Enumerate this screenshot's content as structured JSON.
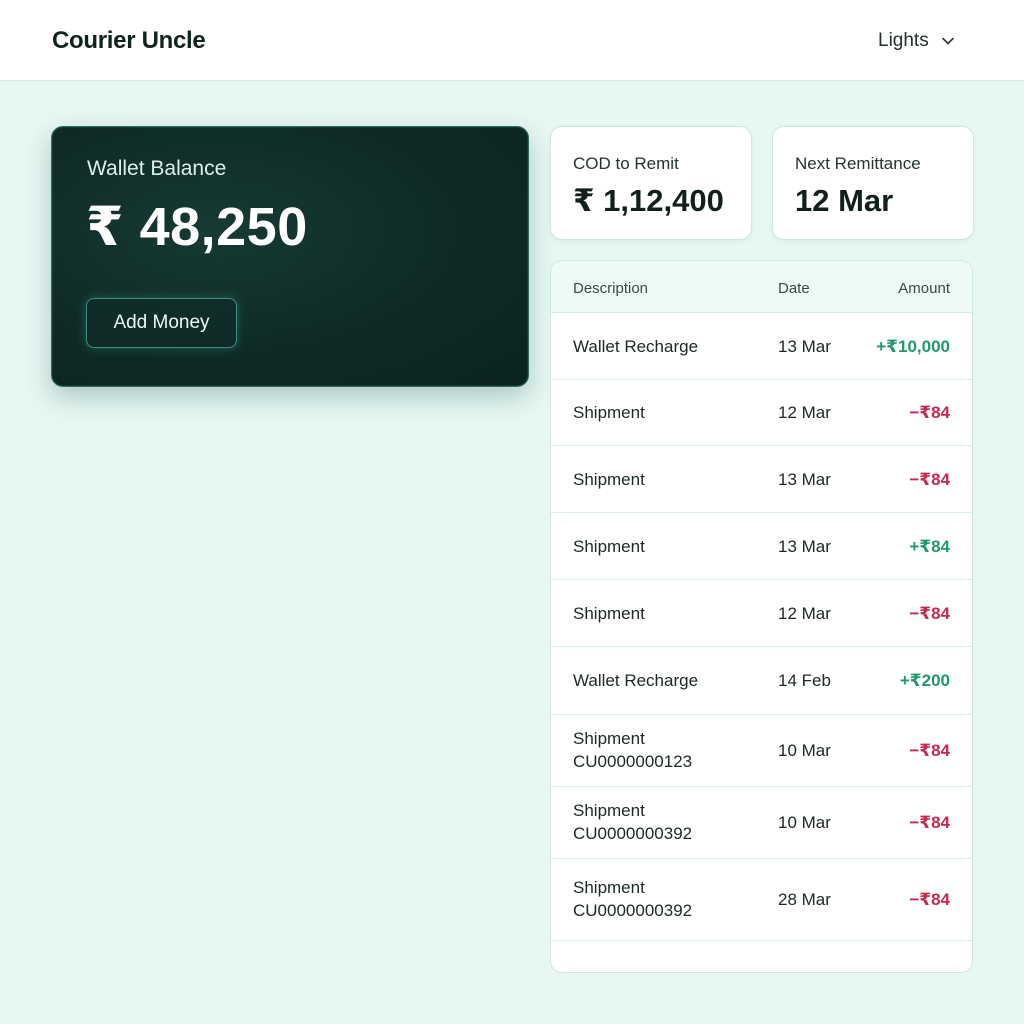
{
  "header": {
    "brand": "Courier Uncle",
    "theme_label": "Lights"
  },
  "wallet": {
    "label": "Wallet Balance",
    "amount": "₹ 48,250",
    "add_button": "Add Money"
  },
  "stats": {
    "cod": {
      "label": "COD to Remit",
      "value": "₹ 1,12,400"
    },
    "next": {
      "label": "Next Remittance",
      "value": "12 Mar"
    }
  },
  "table": {
    "headers": {
      "description": "Description",
      "date": "Date",
      "amount": "Amount"
    },
    "rows": [
      {
        "description": "Wallet Recharge",
        "date": "13 Mar",
        "amount": "+₹10,000",
        "sign": "positive"
      },
      {
        "description": "Shipment",
        "date": "12 Mar",
        "amount": "−₹84",
        "sign": "negative"
      },
      {
        "description": "Shipment",
        "date": "13 Mar",
        "amount": "−₹84",
        "sign": "negative"
      },
      {
        "description": "Shipment",
        "date": "13 Mar",
        "amount": "+₹84",
        "sign": "positive"
      },
      {
        "description": "Shipment",
        "date": "12 Mar",
        "amount": "−₹84",
        "sign": "negative"
      },
      {
        "description": "Wallet Recharge",
        "date": "14 Feb",
        "amount": "+₹200",
        "sign": "positive"
      },
      {
        "description": "Shipment CU0000000123",
        "date": "10 Mar",
        "amount": "−₹84",
        "sign": "negative"
      },
      {
        "description": "Shipment CU0000000392",
        "date": "10 Mar",
        "amount": "−₹84",
        "sign": "negative"
      },
      {
        "description": "Shipment CU0000000392",
        "date": "28 Mar",
        "amount": "−₹84",
        "sign": "negative"
      }
    ]
  },
  "colors": {
    "positive": "#1f9a6a",
    "negative": "#c6284e",
    "wallet_card": "#0f2a26",
    "page_background": "#e7f7f3"
  },
  "icons": {
    "theme_dropdown": "chevron-down-icon"
  }
}
